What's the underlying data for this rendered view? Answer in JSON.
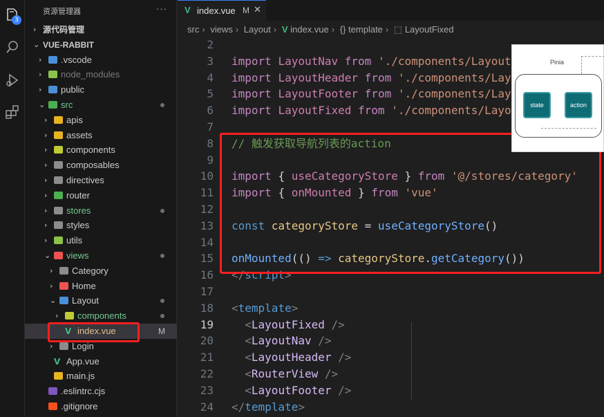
{
  "activity_bar": {
    "items": [
      {
        "icon": "files-icon",
        "badge": "3"
      },
      {
        "icon": "search-icon"
      },
      {
        "icon": "run-debug-icon"
      },
      {
        "icon": "extensions-icon"
      }
    ]
  },
  "explorer": {
    "title": "资源管理器",
    "more": "···",
    "tree": [
      {
        "label": "源代码管理",
        "depth": 0,
        "chev": "›",
        "icon": "",
        "color": "#cccccc",
        "bold": true
      },
      {
        "label": "VUE-RABBIT",
        "depth": 0,
        "chev": "⌄",
        "icon": "",
        "color": "#cccccc",
        "bold": true
      },
      {
        "label": ".vscode",
        "depth": 1,
        "chev": "›",
        "icon": "#4a90d9",
        "color": "#cccccc"
      },
      {
        "label": "node_modules",
        "depth": 1,
        "chev": "›",
        "icon": "#8bc34a",
        "color": "#7a7a7a"
      },
      {
        "label": "public",
        "depth": 1,
        "chev": "›",
        "icon": "#4a90d9",
        "color": "#cccccc"
      },
      {
        "label": "src",
        "depth": 1,
        "chev": "⌄",
        "icon": "#4caf50",
        "color": "#73c991",
        "dot": true
      },
      {
        "label": "apis",
        "depth": 2,
        "chev": "›",
        "icon": "#e6b422",
        "color": "#cccccc"
      },
      {
        "label": "assets",
        "depth": 2,
        "chev": "›",
        "icon": "#e6b422",
        "color": "#cccccc"
      },
      {
        "label": "components",
        "depth": 2,
        "chev": "›",
        "icon": "#c0ca33",
        "color": "#cccccc"
      },
      {
        "label": "composables",
        "depth": 2,
        "chev": "›",
        "icon": "#8c8c8c",
        "color": "#cccccc"
      },
      {
        "label": "directives",
        "depth": 2,
        "chev": "›",
        "icon": "#8c8c8c",
        "color": "#cccccc"
      },
      {
        "label": "router",
        "depth": 2,
        "chev": "›",
        "icon": "#4caf50",
        "color": "#cccccc"
      },
      {
        "label": "stores",
        "depth": 2,
        "chev": "›",
        "icon": "#8c8c8c",
        "color": "#73c991",
        "dot": true
      },
      {
        "label": "styles",
        "depth": 2,
        "chev": "›",
        "icon": "#8c8c8c",
        "color": "#cccccc"
      },
      {
        "label": "utils",
        "depth": 2,
        "chev": "›",
        "icon": "#8bc34a",
        "color": "#cccccc"
      },
      {
        "label": "views",
        "depth": 2,
        "chev": "⌄",
        "icon": "#ef5350",
        "color": "#73c991",
        "dot": true
      },
      {
        "label": "Category",
        "depth": 3,
        "chev": "›",
        "icon": "#8c8c8c",
        "color": "#cccccc"
      },
      {
        "label": "Home",
        "depth": 3,
        "chev": "›",
        "icon": "#ef5350",
        "color": "#cccccc"
      },
      {
        "label": "Layout",
        "depth": 3,
        "chev": "⌄",
        "icon": "#4a90d9",
        "color": "#cccccc",
        "dot": true
      },
      {
        "label": "components",
        "depth": 4,
        "chev": "›",
        "icon": "#c0ca33",
        "color": "#73c991",
        "dot": true
      },
      {
        "label": "index.vue",
        "depth": 4,
        "chev": "",
        "icon": "vue",
        "color": "#e2c08d",
        "flag": "M",
        "selected": true
      },
      {
        "label": "Login",
        "depth": 3,
        "chev": "›",
        "icon": "#8c8c8c",
        "color": "#cccccc"
      },
      {
        "label": "App.vue",
        "depth": 2,
        "chev": "",
        "icon": "vue",
        "color": "#cccccc"
      },
      {
        "label": "main.js",
        "depth": 2,
        "chev": "",
        "icon": "#e6b422",
        "color": "#cccccc"
      },
      {
        "label": ".eslintrc.cjs",
        "depth": 1,
        "chev": "",
        "icon": "#7e57c2",
        "color": "#cccccc"
      },
      {
        "label": ".gitignore",
        "depth": 1,
        "chev": "",
        "icon": "#f4511e",
        "color": "#cccccc"
      }
    ]
  },
  "tab": {
    "icon": "V",
    "name": "index.vue",
    "modified": "M",
    "close": "✕"
  },
  "breadcrumb": [
    "src",
    "views",
    "Layout",
    "index.vue",
    "template",
    "LayoutFixed"
  ],
  "code": {
    "active_line": "19",
    "lines": [
      {
        "n": "2",
        "t": []
      },
      {
        "n": "3",
        "t": [
          [
            "kw",
            "import "
          ],
          [
            "id",
            "LayoutNav "
          ],
          [
            "kw",
            "from "
          ],
          [
            "str",
            "'./components/LayoutN"
          ]
        ]
      },
      {
        "n": "4",
        "t": [
          [
            "kw",
            "import "
          ],
          [
            "id",
            "LayoutHeader "
          ],
          [
            "kw",
            "from "
          ],
          [
            "str",
            "'./components/Layo"
          ]
        ]
      },
      {
        "n": "5",
        "t": [
          [
            "kw",
            "import "
          ],
          [
            "id",
            "LayoutFooter "
          ],
          [
            "kw",
            "from "
          ],
          [
            "str",
            "'./components/Layo"
          ]
        ]
      },
      {
        "n": "6",
        "t": [
          [
            "kw",
            "import "
          ],
          [
            "id",
            "LayoutFixed "
          ],
          [
            "kw",
            "from "
          ],
          [
            "str",
            "'./components/Layou"
          ]
        ]
      },
      {
        "n": "7",
        "t": []
      },
      {
        "n": "8",
        "t": [
          [
            "cm",
            "// 触发获取导航列表的action"
          ]
        ]
      },
      {
        "n": "9",
        "t": []
      },
      {
        "n": "10",
        "t": [
          [
            "kw",
            "import "
          ],
          [
            "pl",
            "{ "
          ],
          [
            "id",
            "useCategoryStore "
          ],
          [
            "pl",
            "} "
          ],
          [
            "kw",
            "from "
          ],
          [
            "str",
            "'@/stores/category'"
          ]
        ]
      },
      {
        "n": "11",
        "t": [
          [
            "kw",
            "import "
          ],
          [
            "pl",
            "{ "
          ],
          [
            "id",
            "onMounted "
          ],
          [
            "pl",
            "} "
          ],
          [
            "kw",
            "from "
          ],
          [
            "str",
            "'vue'"
          ]
        ]
      },
      {
        "n": "12",
        "t": []
      },
      {
        "n": "13",
        "t": [
          [
            "blue",
            "const "
          ],
          [
            "var",
            "categoryStore "
          ],
          [
            "pl",
            "= "
          ],
          [
            "fn",
            "useCategoryStore"
          ],
          [
            "pl",
            "()"
          ]
        ]
      },
      {
        "n": "14",
        "t": []
      },
      {
        "n": "15",
        "t": [
          [
            "fn",
            "onMounted"
          ],
          [
            "pl",
            "(() "
          ],
          [
            "blue",
            "=> "
          ],
          [
            "var",
            "categoryStore"
          ],
          [
            "pl",
            "."
          ],
          [
            "fn",
            "getCategory"
          ],
          [
            "pl",
            "())"
          ]
        ]
      },
      {
        "n": "16",
        "t": [
          [
            "tag",
            "</"
          ],
          [
            "blue",
            "script"
          ],
          [
            "tag",
            ">"
          ]
        ]
      },
      {
        "n": "17",
        "t": []
      },
      {
        "n": "18",
        "t": [
          [
            "tag",
            "<"
          ],
          [
            "blue",
            "template"
          ],
          [
            "tag",
            ">"
          ]
        ]
      },
      {
        "n": "19",
        "t": [
          [
            "pl",
            "  "
          ],
          [
            "tag",
            "<"
          ],
          [
            "tname",
            "LayoutFixed "
          ],
          [
            "tag",
            "/>"
          ]
        ]
      },
      {
        "n": "20",
        "t": [
          [
            "pl",
            "  "
          ],
          [
            "tag",
            "<"
          ],
          [
            "tname",
            "LayoutNav "
          ],
          [
            "tag",
            "/>"
          ]
        ]
      },
      {
        "n": "21",
        "t": [
          [
            "pl",
            "  "
          ],
          [
            "tag",
            "<"
          ],
          [
            "tname",
            "LayoutHeader "
          ],
          [
            "tag",
            "/>"
          ]
        ]
      },
      {
        "n": "22",
        "t": [
          [
            "pl",
            "  "
          ],
          [
            "tag",
            "<"
          ],
          [
            "tname",
            "RouterView "
          ],
          [
            "tag",
            "/>"
          ]
        ]
      },
      {
        "n": "23",
        "t": [
          [
            "pl",
            "  "
          ],
          [
            "tag",
            "<"
          ],
          [
            "tname",
            "LayoutFooter "
          ],
          [
            "tag",
            "/>"
          ]
        ]
      },
      {
        "n": "24",
        "t": [
          [
            "tag",
            "</"
          ],
          [
            "blue",
            "template"
          ],
          [
            "tag",
            ">"
          ]
        ]
      }
    ]
  },
  "pinia_diagram": {
    "title": "Pinia",
    "left_node": "state",
    "right_node": "action"
  },
  "colors": {
    "accent": "#3b82f6",
    "highlight_box": "#ff1f1f",
    "vue_green": "#41b883"
  }
}
